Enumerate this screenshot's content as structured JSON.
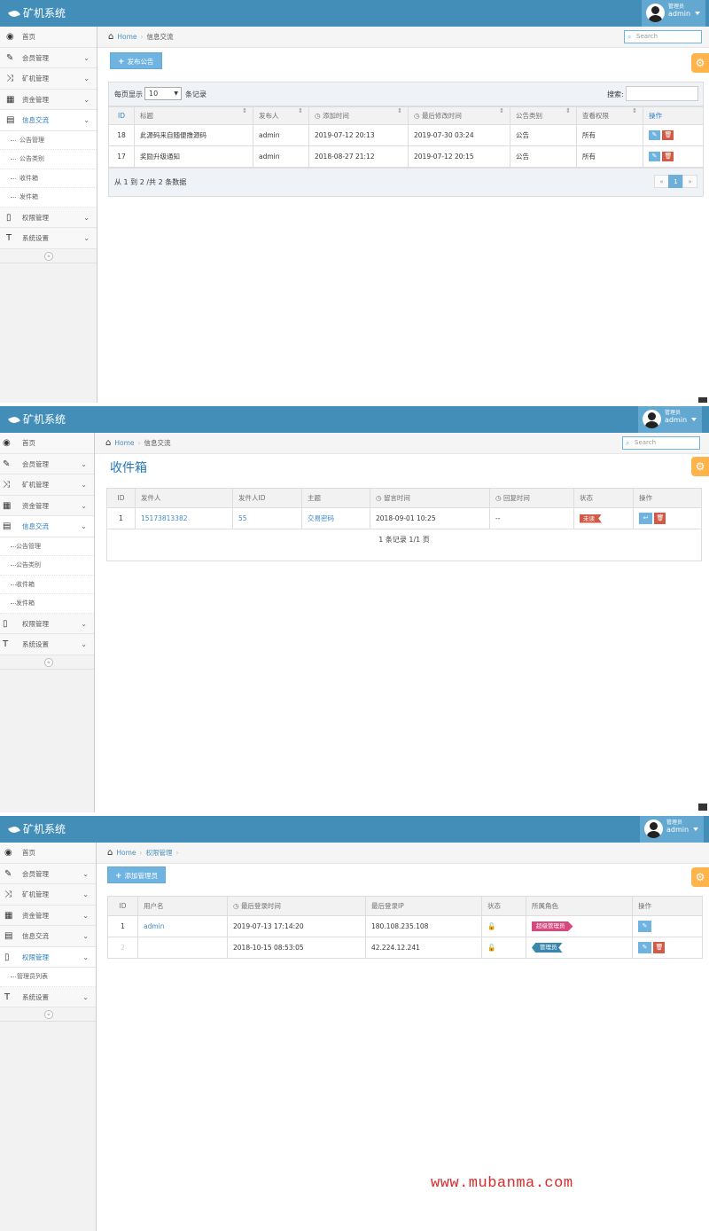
{
  "app": {
    "title": "矿机系统"
  },
  "user": {
    "role": "管理员",
    "name": "admin"
  },
  "common": {
    "search_placeholder": "Search",
    "home": "Home"
  },
  "sidebar": {
    "items": [
      "首页",
      "会员管理",
      "矿机管理",
      "资金管理",
      "信息交流",
      "权限管理",
      "系统设置"
    ],
    "info_sub": [
      "公告管理",
      "公告类别",
      "收件箱",
      "发件箱"
    ],
    "perm_sub": [
      "管理员列表"
    ],
    "collapse_icon": "«"
  },
  "screen1": {
    "breadcrumb": "信息交流",
    "add_button": "发布公告",
    "page_size_label": "每页显示",
    "page_size_value": "10",
    "page_size_suffix": "条记录",
    "search_label": "搜索:",
    "columns": [
      "ID",
      "标题",
      "发布人",
      "添加时间",
      "最后修改时间",
      "公告类别",
      "查看权限",
      "操作"
    ],
    "rows": [
      [
        "18",
        "此源码来自随便撸源码",
        "admin",
        "2019-07-12 20:13",
        "2019-07-30 03:24",
        "公告",
        "所有"
      ],
      [
        "17",
        "奖励升级通知",
        "admin",
        "2018-08-27 21:12",
        "2019-07-12 20:15",
        "公告",
        "所有"
      ]
    ],
    "info_text": "从 1 到 2 /共 2 条数据",
    "pager": [
      "«",
      "1",
      "»"
    ]
  },
  "screen2": {
    "breadcrumb": "信息交流",
    "page_title": "收件箱",
    "columns": [
      "ID",
      "发件人",
      "发件人ID",
      "主题",
      "留言时间",
      "回复时间",
      "状态",
      "操作"
    ],
    "rows": [
      [
        "1",
        "15173813382",
        "55",
        "交易密码",
        "2018-09-01 10:25",
        "--",
        "未读"
      ]
    ],
    "footer_text": "1 条记录 1/1 页"
  },
  "screen3": {
    "breadcrumb": "权限管理",
    "add_button": "添加管理员",
    "columns": [
      "ID",
      "用户名",
      "最后登录时间",
      "最后登录IP",
      "状态",
      "所属角色",
      "操作"
    ],
    "rows": [
      [
        "1",
        "admin",
        "2019-07-13 17:14:20",
        "180.108.235.108",
        "超级管理员"
      ],
      [
        "2",
        "",
        "2018-10-15 08:53:05",
        "42.224.12.241",
        "管理员"
      ]
    ]
  },
  "icons": {
    "dashboard": "dashboard-icon",
    "edit": "pencil-square-icon",
    "random": "shuffle-icon",
    "calendar": "calendar-icon",
    "list": "list-alt-icon",
    "file": "file-icon",
    "text": "text-icon",
    "home": "home-icon",
    "search": "search-icon",
    "gear": "gear-icon",
    "leaf": "leaf-icon",
    "reply": "reply-icon",
    "trash": "trash-icon",
    "unlock": "unlock-icon",
    "clock": "clock-icon"
  },
  "colors": {
    "navbar": "#438eb9",
    "primary_button": "#6fb3e0",
    "danger": "#d15b47",
    "settings": "#ffb44b"
  },
  "watermark": "www.mubanma.com"
}
